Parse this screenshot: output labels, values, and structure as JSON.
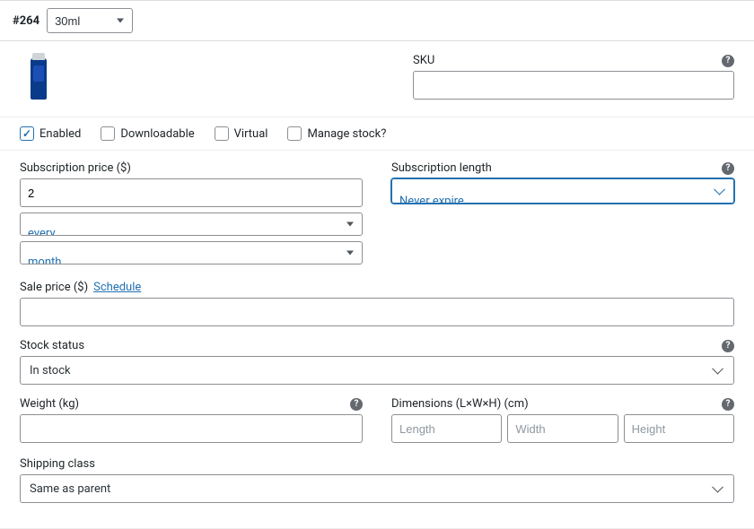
{
  "header": {
    "variation_id": "#264",
    "attribute_value": "30ml"
  },
  "sku": {
    "label": "SKU",
    "value": ""
  },
  "checkboxes": {
    "enabled": {
      "label": "Enabled",
      "checked": true
    },
    "downloadable": {
      "label": "Downloadable",
      "checked": false
    },
    "virtual": {
      "label": "Virtual",
      "checked": false
    },
    "manage_stock": {
      "label": "Manage stock?",
      "checked": false
    }
  },
  "subscription": {
    "price_label": "Subscription price ($)",
    "price_value": "2",
    "interval_value": "every",
    "period_value": "month",
    "length_label": "Subscription length",
    "length_value": "Never expire"
  },
  "sale": {
    "label": "Sale price ($)",
    "schedule_link": "Schedule",
    "value": ""
  },
  "stock": {
    "label": "Stock status",
    "value": "In stock"
  },
  "weight": {
    "label": "Weight (kg)",
    "value": ""
  },
  "dimensions": {
    "label": "Dimensions (L×W×H) (cm)",
    "length_placeholder": "Length",
    "width_placeholder": "Width",
    "height_placeholder": "Height"
  },
  "shipping": {
    "label": "Shipping class",
    "value": "Same as parent"
  },
  "help_glyph": "?"
}
